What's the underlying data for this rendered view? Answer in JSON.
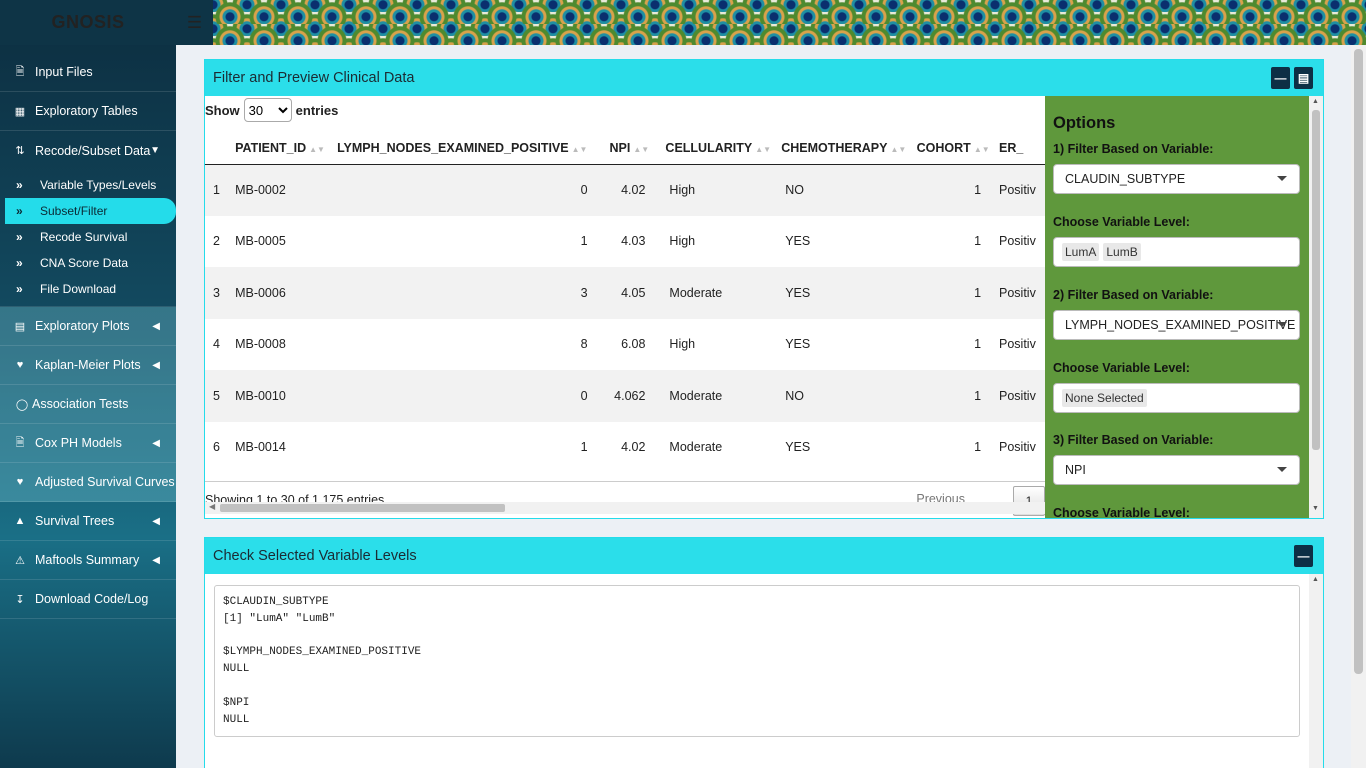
{
  "app": {
    "brand": "GNOSIS",
    "menu_toggle_icon": "hamburger-icon"
  },
  "sidebar": {
    "items": [
      {
        "label": "Input Files",
        "icon": "file-icon"
      },
      {
        "label": "Exploratory Tables",
        "icon": "table-icon"
      },
      {
        "label": "Recode/Subset Data",
        "icon": "sort-icon",
        "expanded": true,
        "children": [
          {
            "label": "Variable Types/Levels"
          },
          {
            "label": "Subset/Filter",
            "active": true
          },
          {
            "label": "Recode Survival"
          },
          {
            "label": "CNA Score Data"
          },
          {
            "label": "File Download"
          }
        ]
      },
      {
        "label": "Exploratory Plots",
        "icon": "chart-icon"
      },
      {
        "label": "Kaplan-Meier Plots",
        "icon": "heartbeat-icon"
      },
      {
        "label": "Association Tests",
        "icon": "circle-icon"
      },
      {
        "label": "Cox PH Models",
        "icon": "file-icon"
      },
      {
        "label": "Adjusted Survival Curves",
        "icon": "heartbeat-icon"
      },
      {
        "label": "Survival Trees",
        "icon": "tree-icon"
      },
      {
        "label": "Maftools Summary",
        "icon": "warning-icon"
      },
      {
        "label": "Download Code/Log",
        "icon": "download-icon"
      }
    ]
  },
  "box1": {
    "title": "Filter and Preview Clinical Data",
    "length": {
      "show": "Show",
      "value": "30",
      "entries": "entries"
    },
    "columns": [
      "",
      "PATIENT_ID",
      "LYMPH_NODES_EXAMINED_POSITIVE",
      "NPI",
      "CELLULARITY",
      "CHEMOTHERAPY",
      "COHORT",
      "ER_"
    ],
    "rows": [
      [
        "1",
        "MB-0002",
        "0",
        "4.02",
        "High",
        "NO",
        "1",
        "Positiv"
      ],
      [
        "2",
        "MB-0005",
        "1",
        "4.03",
        "High",
        "YES",
        "1",
        "Positiv"
      ],
      [
        "3",
        "MB-0006",
        "3",
        "4.05",
        "Moderate",
        "YES",
        "1",
        "Positiv"
      ],
      [
        "4",
        "MB-0008",
        "8",
        "6.08",
        "High",
        "YES",
        "1",
        "Positiv"
      ],
      [
        "5",
        "MB-0010",
        "0",
        "4.062",
        "Moderate",
        "NO",
        "1",
        "Positiv"
      ],
      [
        "6",
        "MB-0014",
        "1",
        "4.02",
        "Moderate",
        "YES",
        "1",
        "Positiv"
      ]
    ],
    "info": "Showing 1 to 30 of 1,175 entries",
    "pagination": {
      "previous": "Previous",
      "page": "1"
    }
  },
  "options": {
    "title": "Options",
    "filter1": {
      "label": "1) Filter Based on Variable:",
      "value": "CLAUDIN_SUBTYPE",
      "level_label": "Choose Variable Level:",
      "levels": [
        "LumA",
        "LumB"
      ]
    },
    "filter2": {
      "label": "2) Filter Based on Variable:",
      "value": "LYMPH_NODES_EXAMINED_POSITIVE",
      "level_label": "Choose Variable Level:",
      "levels": [
        "None Selected"
      ]
    },
    "filter3": {
      "label": "3) Filter Based on Variable:",
      "value": "NPI",
      "level_label": "Choose Variable Level:"
    }
  },
  "box2": {
    "title": "Check Selected Variable Levels",
    "output": "$CLAUDIN_SUBTYPE\n[1] \"LumA\" \"LumB\"\n\n$LYMPH_NODES_EXAMINED_POSITIVE\nNULL\n\n$NPI\nNULL"
  },
  "colors": {
    "accent": "#2bdeea",
    "options_bg": "#5f983c",
    "sidebar_dark": "#0c2d3f",
    "button_dark": "#0d2f45"
  }
}
